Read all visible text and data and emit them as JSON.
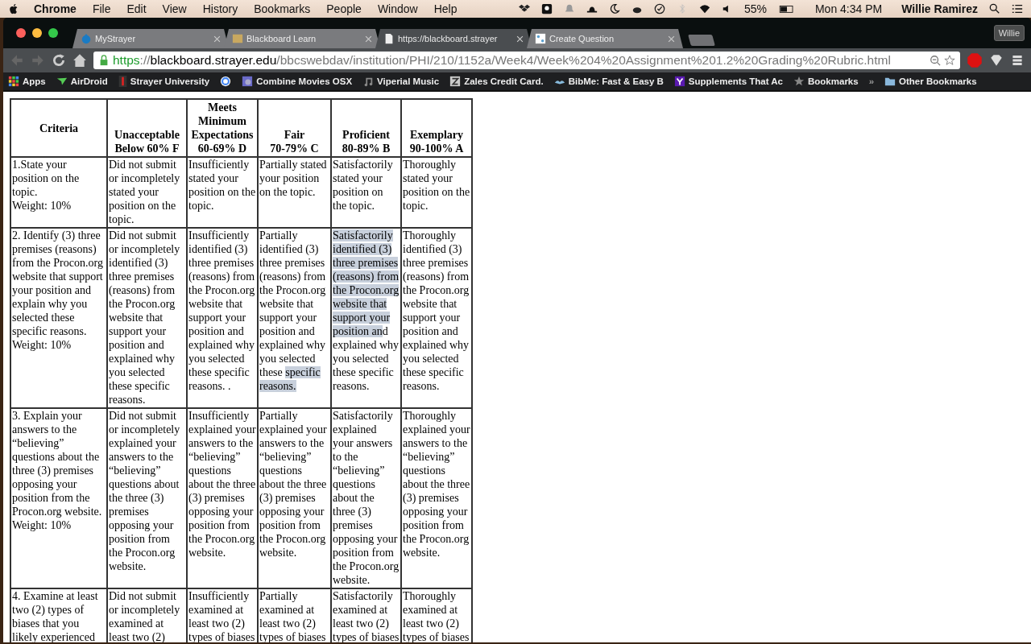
{
  "menubar": {
    "app": "Chrome",
    "items": [
      "File",
      "Edit",
      "View",
      "History",
      "Bookmarks",
      "People",
      "Window",
      "Help"
    ],
    "battery": "55%",
    "clock": "Mon 4:34 PM",
    "user": "Willie Ramirez"
  },
  "tabs": [
    {
      "title": "MyStrayer",
      "kind": "drop",
      "selected": false
    },
    {
      "title": "Blackboard Learn",
      "kind": "bb",
      "selected": false
    },
    {
      "title": "https://blackboard.strayer",
      "kind": "page",
      "selected": true
    },
    {
      "title": "Create Question",
      "kind": "grid",
      "selected": false
    }
  ],
  "profile": "Willie",
  "address": {
    "scheme": "https",
    "separator": "://",
    "host": "blackboard.strayer.edu",
    "path": "/bbcswebdav/institution/PHI/210/1152a/Week4/Week%204%20Assignment%201.2%20Grading%20Rubric.html"
  },
  "bookmarks": [
    {
      "label": "Apps",
      "kind": "apps"
    },
    {
      "label": "AirDroid",
      "kind": "plane"
    },
    {
      "label": "Strayer University",
      "kind": "logo"
    },
    {
      "kind": "google"
    },
    {
      "label": "Combine Movies OSX",
      "kind": "image"
    },
    {
      "label": "Viperial Music",
      "kind": "music"
    },
    {
      "label": "Zales Credit Card.",
      "kind": "letter"
    },
    {
      "label": "BibMe: Fast & Easy B",
      "kind": "book"
    },
    {
      "label": "Supplements That Ac",
      "kind": "yahoo"
    },
    {
      "label": "Bookmarks",
      "kind": "star"
    }
  ],
  "other_bookmarks": "Other Bookmarks",
  "overflow": "»",
  "table": {
    "columns": [
      {
        "title": "Criteria"
      },
      {
        "title": "Unacceptable",
        "range": "Below 60% F"
      },
      {
        "title": "Meets Minimum Expectations",
        "range": "60-69% D"
      },
      {
        "title": "Fair",
        "range": "70-79% C"
      },
      {
        "title": "Proficient",
        "range": "80-89% B"
      },
      {
        "title": "Exemplary",
        "range": "90-100% A"
      }
    ],
    "rows": [
      [
        "1.State your position on the topic.\nWeight: 10%",
        "Did not submit or incompletely stated your position on the topic.",
        "Insufficiently stated your position on the topic.",
        "Partially stated your position on the topic.",
        "Satisfactorily stated your position on the topic.",
        "Thoroughly stated your position on the topic."
      ],
      [
        "2. Identify (3) three premises (reasons) from the Procon.org website that support your position and explain why you selected these specific reasons.\nWeight: 10%",
        "Did not submit or incompletely identified (3) three premises (reasons) from the Procon.org website that support your position and explained why you selected these specific reasons.",
        "Insufficiently identified (3) three premises (reasons) from the Procon.org website that support your position and explained why you selected these specific reasons. .",
        {
          "segments": [
            {
              "text": "Partially identified (3) three premises (reasons) from the Procon.org website that support your position and explained why you selected these ",
              "highlighted": false
            },
            {
              "text": "specific reasons.",
              "highlighted": true
            }
          ]
        },
        {
          "segments": [
            {
              "text": "Satisfactorily identified (3) three premises (reasons) from the Procon.org website that support your position an",
              "highlighted": true
            },
            {
              "text": "d explained why you selected these specific reasons.",
              "highlighted": false
            }
          ]
        },
        "Thoroughly identified (3) three premises (reasons) from the Procon.org website that support your position and explained why you selected these specific reasons."
      ],
      [
        "3. Explain your answers to the “believing” questions about the three (3) premises opposing your position from the Procon.org website.\nWeight: 10%",
        "Did not submit or incompletely explained your answers to the “believing” questions about the three (3) premises opposing your position from the Procon.org website.",
        "Insufficiently explained your answers to the “believing” questions about the three (3) premises opposing your position from the Procon.org website.",
        "Partially explained your answers to the “believing” questions about the three (3) premises opposing your position from the Procon.org website.",
        "Satisfactorily explained your answers to the “believing” questions about the three (3) premises opposing your position from the Procon.org website.",
        "Thoroughly explained your answers to the “believing” questions about the three (3) premises opposing your position from the Procon.org website."
      ],
      [
        "4. Examine at least two (2) types of biases that you likely experienced",
        "Did not submit or incompletely examined at least two (2)",
        "Insufficiently examined at least two (2) types of biases",
        "Partially examined at least two (2) types of biases",
        "Satisfactorily examined at least two (2) types of biases",
        "Thoroughly examined at least two (2) types of biases"
      ]
    ]
  }
}
